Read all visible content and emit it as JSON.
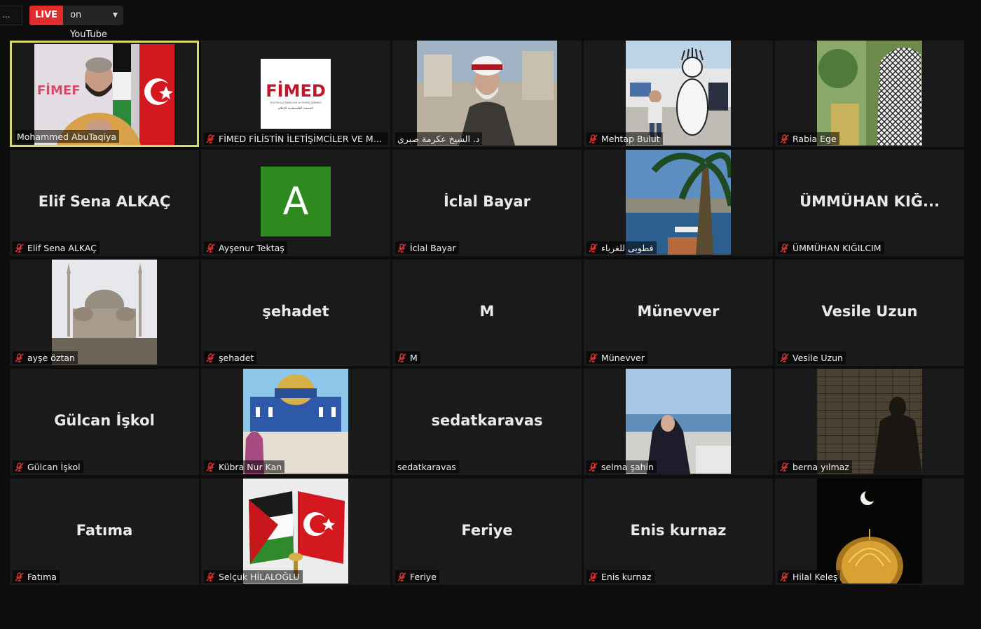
{
  "topbar": {
    "menu_label": "...",
    "live_badge": "LIVE",
    "live_target": "on YouTube"
  },
  "colors": {
    "background": "#0d0d0d",
    "tile": "#1a1a1a",
    "active_border": "#d9d96a",
    "live_red": "#e02c2c",
    "muted_mic": "#e0332e"
  },
  "participants": [
    {
      "name": "Mohammed AbuTaqiya",
      "display": "",
      "muted": false,
      "active": true,
      "video": "speaker-flags"
    },
    {
      "name": "FİMED FİLİSTİN İLETİŞİMCİLER VE MEDY...",
      "display": "",
      "muted": true,
      "video": "fimed-logo",
      "logo_text": "FİMED",
      "logo_sub": "FİLİSTİN İLETİŞİMCİLER VE MEDYA DERNEĞİ",
      "logo_arabic": "الجمعية الفلسطينية للإعلام"
    },
    {
      "name": "د. الشيخ عكرمة صبري",
      "display": "",
      "muted": false,
      "video": "elder-sheikh"
    },
    {
      "name": "Mehtap Bulut",
      "display": "",
      "muted": true,
      "video": "child-mural"
    },
    {
      "name": "Rabia Ege",
      "display": "",
      "muted": true,
      "video": "keffiyeh"
    },
    {
      "name": "Elif Sena ALKAÇ",
      "display": "Elif Sena ALKAÇ",
      "muted": true
    },
    {
      "name": "Ayşenur Tektaş",
      "display": "",
      "muted": true,
      "video": "avatar-letter",
      "avatar_letter": "A"
    },
    {
      "name": "İclal Bayar",
      "display": "İclal Bayar",
      "muted": true
    },
    {
      "name": "قطوبى للغرباء",
      "display": "",
      "muted": true,
      "video": "bosphorus"
    },
    {
      "name": "ÜMMÜHAN KIĞILCIM",
      "display": "ÜMMÜHAN  KIĞ...",
      "muted": true
    },
    {
      "name": "ayşe öztan",
      "display": "",
      "muted": true,
      "video": "mosque"
    },
    {
      "name": "şehadet",
      "display": "şehadet",
      "muted": true
    },
    {
      "name": "M",
      "display": "M",
      "muted": true
    },
    {
      "name": "Münevver",
      "display": "Münevver",
      "muted": true
    },
    {
      "name": "Vesile Uzun",
      "display": "Vesile Uzun",
      "muted": true
    },
    {
      "name": "Gülcan İşkol",
      "display": "Gülcan İşkol",
      "muted": true
    },
    {
      "name": "Kübra Nur Kan",
      "display": "",
      "muted": true,
      "video": "dome-rock"
    },
    {
      "name": "sedatkaravas",
      "display": "sedatkaravas",
      "muted": false
    },
    {
      "name": "selma şahin",
      "display": "",
      "muted": true,
      "video": "seaside-woman"
    },
    {
      "name": "berna yılmaz",
      "display": "",
      "muted": true,
      "video": "shadow-wall"
    },
    {
      "name": "Fatıma",
      "display": "Fatıma",
      "muted": true
    },
    {
      "name": "Selçuk HİLALOĞLU",
      "display": "",
      "muted": true,
      "video": "pins-flags"
    },
    {
      "name": "Feriye",
      "display": "Feriye",
      "muted": true
    },
    {
      "name": "Enis  kurnaz",
      "display": "Enis  kurnaz",
      "muted": true
    },
    {
      "name": "Hilal Keleş",
      "display": "",
      "muted": true,
      "video": "night-dome"
    }
  ]
}
